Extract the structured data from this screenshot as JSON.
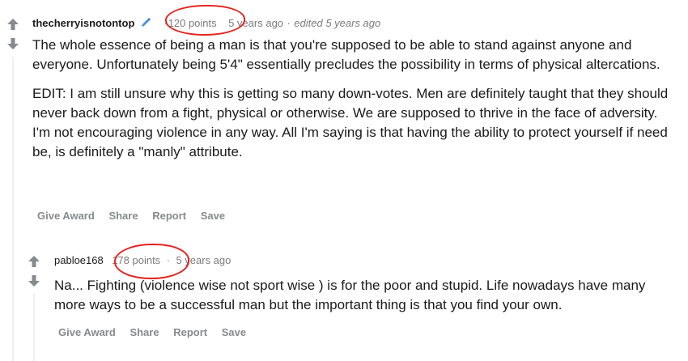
{
  "comments": [
    {
      "author": "thecherryisnotontop",
      "points": "-120 points",
      "separator": "·",
      "age": "5 years ago",
      "edited": "edited 5 years ago",
      "paragraph1": "The whole essence of being a man is that you're supposed to be able to stand against anyone and everyone. Unfortunately being 5'4\" essentially precludes the possibility in terms of physical altercations.",
      "paragraph2": "EDIT: I am still unsure why this is getting so many down-votes. Men are definitely taught that they should never back down from a fight, physical or otherwise. We are supposed to thrive in the face of adversity. I'm not encouraging violence in any way. All I'm saying is that having the ability to protect yourself if need be, is definitely a \"manly\" attribute.",
      "actions": {
        "give_award": "Give Award",
        "share": "Share",
        "report": "Report",
        "save": "Save"
      }
    },
    {
      "author": "pabloe168",
      "points": "178 points",
      "separator": "·",
      "age": "5 years ago",
      "paragraph1": "Na... Fighting (violence wise not sport wise ) is for the poor and stupid. Life nowadays have many more ways to be a successful man but the important thing is that you find your own.",
      "actions": {
        "give_award": "Give Award",
        "share": "Share",
        "report": "Report",
        "save": "Save"
      }
    }
  ],
  "colors": {
    "vote_arrow": "#878a8c",
    "annotation_red": "#e5231e",
    "flair_blue": "#4a90d9"
  },
  "icons": {
    "upvote": "upvote-arrow-icon",
    "downvote": "downvote-arrow-icon",
    "flair": "pencil-icon"
  }
}
